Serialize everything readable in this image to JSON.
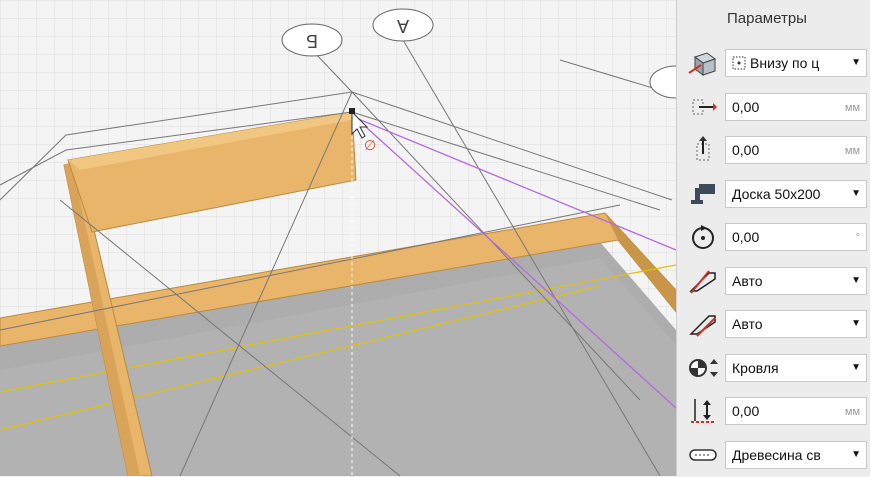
{
  "panel": {
    "title": "Параметры",
    "rows": [
      {
        "id": "placement",
        "icon": "placement-icon",
        "type": "select",
        "value": "Внизу по ц",
        "unit": ""
      },
      {
        "id": "offset-x",
        "icon": "horizontal-offset-icon",
        "type": "number",
        "value": "0,00",
        "unit": "мм"
      },
      {
        "id": "offset-y",
        "icon": "vertical-offset-icon",
        "type": "number",
        "value": "0,00",
        "unit": "мм"
      },
      {
        "id": "profile",
        "icon": "profile-icon",
        "type": "select",
        "value": "Доска 50x200",
        "unit": ""
      },
      {
        "id": "rotation",
        "icon": "rotation-icon",
        "type": "number",
        "value": "0,00",
        "unit": "°"
      },
      {
        "id": "start-cut",
        "icon": "start-cut-icon",
        "type": "select",
        "value": "Авто",
        "unit": ""
      },
      {
        "id": "end-cut",
        "icon": "end-cut-icon",
        "type": "select",
        "value": "Авто",
        "unit": ""
      },
      {
        "id": "layer",
        "icon": "layer-icon",
        "type": "select",
        "value": "Кровля",
        "unit": ""
      },
      {
        "id": "elevation",
        "icon": "elevation-icon",
        "type": "number",
        "value": "0,00",
        "unit": "мм"
      },
      {
        "id": "material",
        "icon": "material-icon",
        "type": "select",
        "value": "Древесина св",
        "unit": ""
      }
    ]
  },
  "viewport": {
    "axis_labels": [
      "Б",
      "А"
    ],
    "colors": {
      "beam": "#e8b56a",
      "beam_dark": "#c99548",
      "grid": "#dcdcdc",
      "floor": "#a9a9a9",
      "guide": "#b46adf",
      "axis": "#e0c300"
    }
  }
}
